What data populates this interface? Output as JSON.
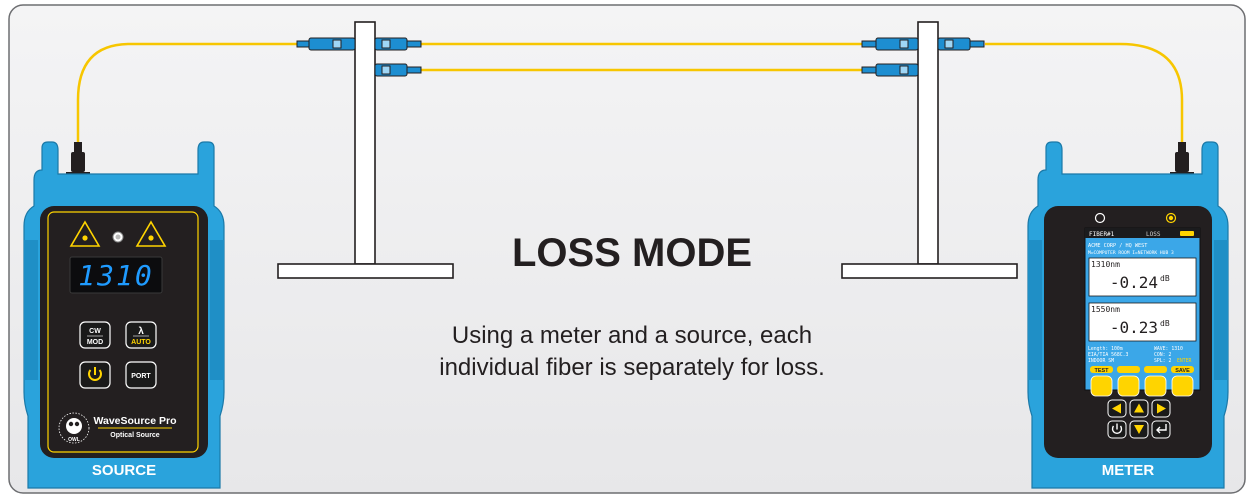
{
  "diagram": {
    "title": "LOSS MODE",
    "description_line1": "Using a meter and a source, each",
    "description_line2": "individual fiber is separately for loss."
  },
  "source": {
    "label": "SOURCE",
    "wavelength_display": "1310",
    "buttons": {
      "cw_top": "CW",
      "cw_bottom": "MOD",
      "lambda_top": "λ",
      "lambda_bottom": "AUTO",
      "port": "PORT"
    },
    "brand_name": "WaveSource Pro",
    "brand_sub": "Optical Source",
    "logo_text": "OWL"
  },
  "meter": {
    "label": "METER",
    "screen": {
      "header_left": "FIBER#1",
      "header_mid": "LOSS",
      "line1": "ACME CORP / HQ WEST",
      "line2": "M=COMPUTER ROOM I=NETWORK HUB 3",
      "reading1_wavelength": "1310nm",
      "reading1_value": "-0.24",
      "reading1_unit": "dB",
      "reading2_wavelength": "1550nm",
      "reading2_value": "-0.23",
      "reading2_unit": "dB",
      "footer_l1": "Length:     100m",
      "footer_r1": "WAVE: 1310",
      "footer_l2": "EIA/TIA 568C.3",
      "footer_r2": "CON: 2",
      "footer_l3": "INDOOR SM",
      "footer_r3": "SPL: 2",
      "footer_enter": "ENTER"
    },
    "softkeys": [
      "TEST",
      "",
      "",
      "SAVE"
    ]
  },
  "colors": {
    "device_blue": "#2aa3dc",
    "device_dark": "#231f20",
    "fiber_yellow": "#f7c600",
    "connector_blue": "#1d8ed1",
    "display_blue": "#1f9bff",
    "screen_blue": "#3ba7e8",
    "button_yellow": "#ffd400"
  }
}
